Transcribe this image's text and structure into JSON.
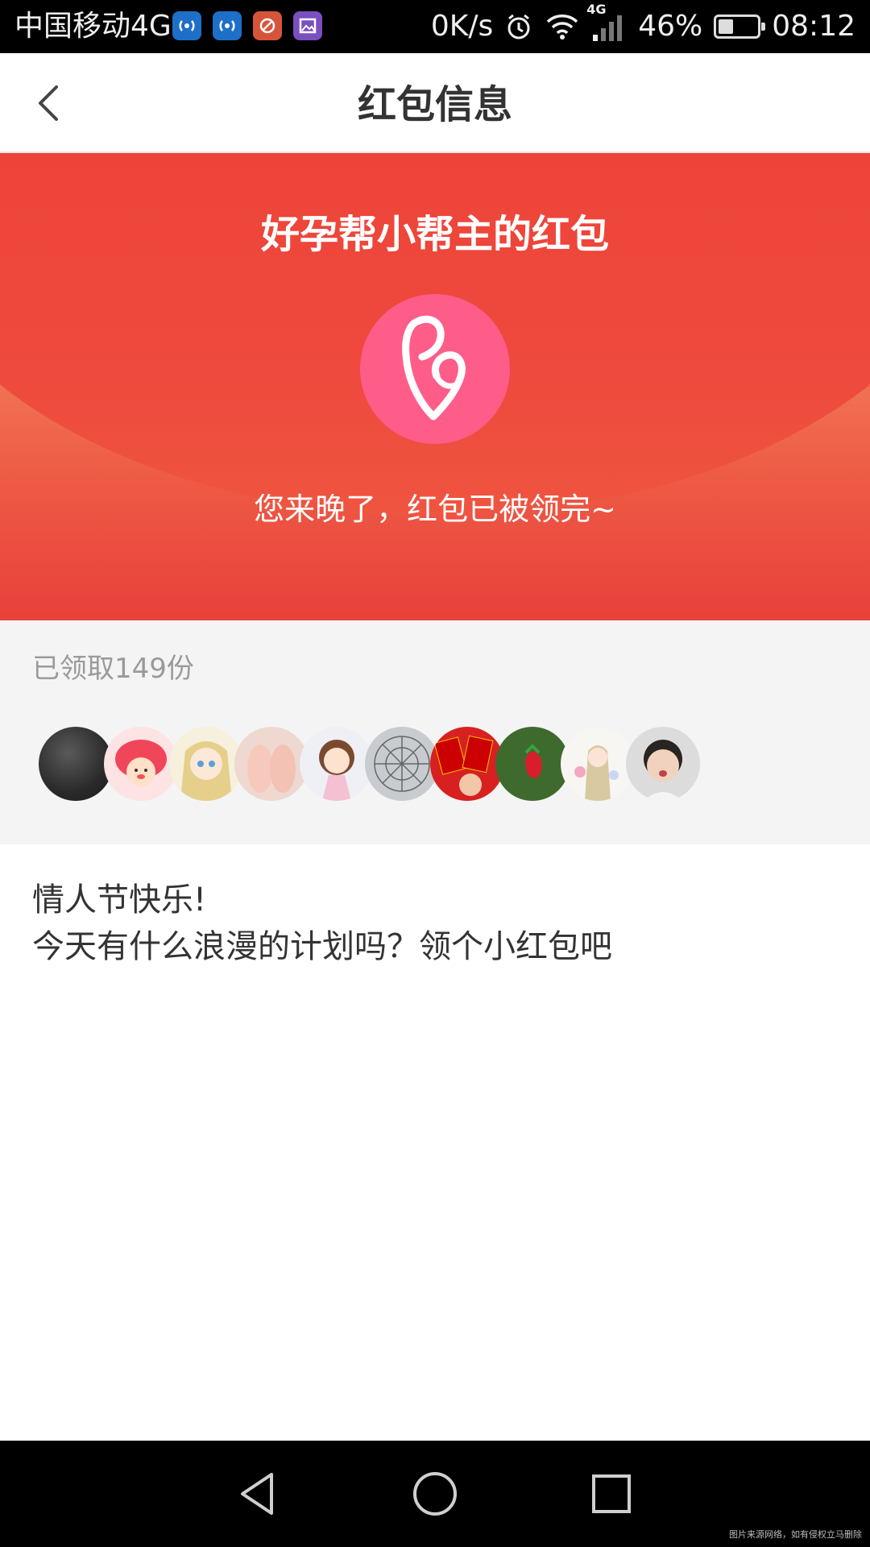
{
  "status_bar": {
    "carrier": "中国移动4G",
    "net_speed": "0K/s",
    "network_type": "4G",
    "battery_percent": "46%",
    "battery_level": 0.46,
    "time": "08:12",
    "app_icons": [
      {
        "name": "wifi-hotspot-icon",
        "color": "#1e6fc8"
      },
      {
        "name": "wifi-hotspot-icon",
        "color": "#1e6fc8"
      },
      {
        "name": "tool-icon",
        "color": "#d6553a"
      },
      {
        "name": "gallery-icon",
        "color": "#7a4fbf"
      }
    ]
  },
  "header": {
    "title": "红包信息",
    "back_icon": "chevron-left-icon"
  },
  "packet": {
    "title": "好孕帮小帮主的红包",
    "status": "您来晚了，红包已被领完~",
    "logo_color": "#fe5d8a",
    "banner_color": "#ee4a3d"
  },
  "claimed": {
    "count_label": "已领取149份",
    "avatars": [
      {
        "name": "avatar-dark-leather"
      },
      {
        "name": "avatar-red-mushroom"
      },
      {
        "name": "avatar-anime-girl"
      },
      {
        "name": "avatar-baby-feet"
      },
      {
        "name": "avatar-doll-girl"
      },
      {
        "name": "avatar-umbrella"
      },
      {
        "name": "avatar-red-envelopes"
      },
      {
        "name": "avatar-strawberry"
      },
      {
        "name": "avatar-flower-girl"
      },
      {
        "name": "avatar-child"
      }
    ]
  },
  "message": {
    "line1": "情人节快乐!",
    "line2": "今天有什么浪漫的计划吗？领个小红包吧"
  },
  "nav": {
    "back_icon": "triangle-back-icon",
    "home_icon": "circle-home-icon",
    "recents_icon": "square-recents-icon"
  },
  "watermark": "图片来源网络，如有侵权立马删除"
}
